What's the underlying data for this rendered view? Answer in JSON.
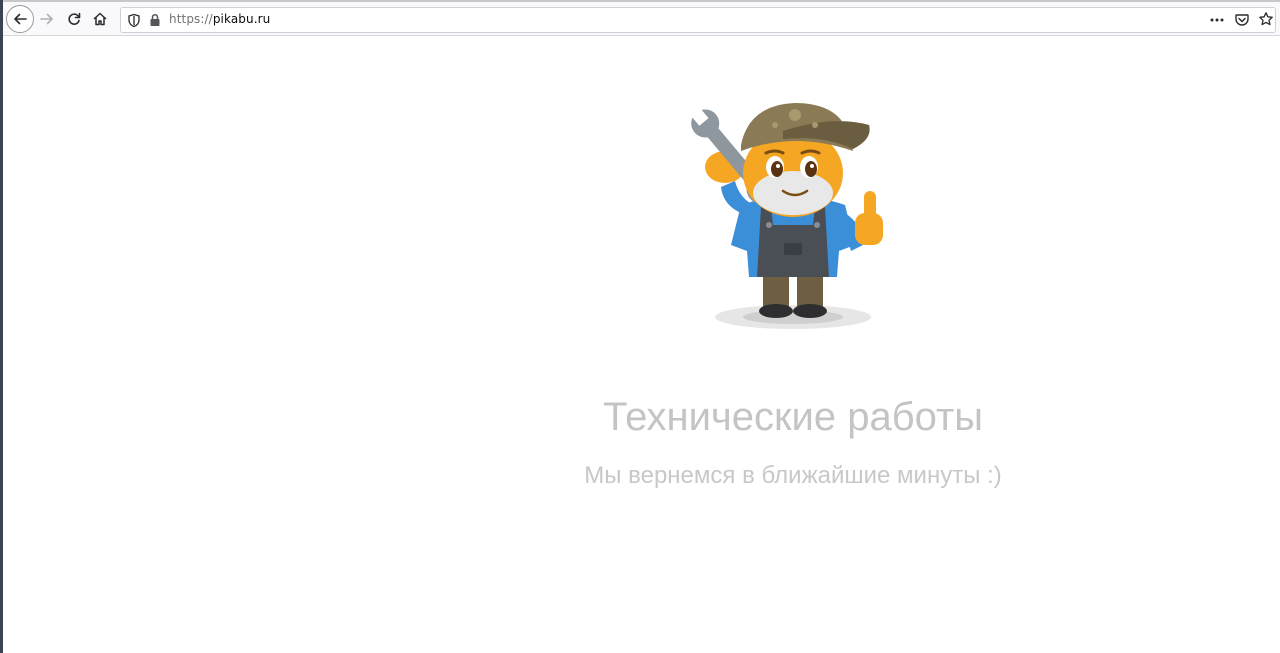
{
  "browser": {
    "url_scheme": "https://",
    "url_host": "pikabu.ru",
    "icons": {
      "back": "arrow-left-icon",
      "forward": "arrow-right-icon",
      "reload": "reload-icon",
      "home": "home-icon",
      "tracking": "shield-icon",
      "secure": "lock-icon",
      "page_actions": "more-horizontal-icon",
      "pocket": "pocket-icon",
      "bookmark": "star-icon"
    }
  },
  "page": {
    "title": "Технические работы",
    "subtitle": "Мы вернемся в ближайшие минуты :)"
  },
  "colors": {
    "text_muted": "#c4c4c4",
    "shirt": "#3b8fd9",
    "skin": "#f5a623",
    "overalls": "#4a4f55",
    "cap": "#8a7a55"
  }
}
